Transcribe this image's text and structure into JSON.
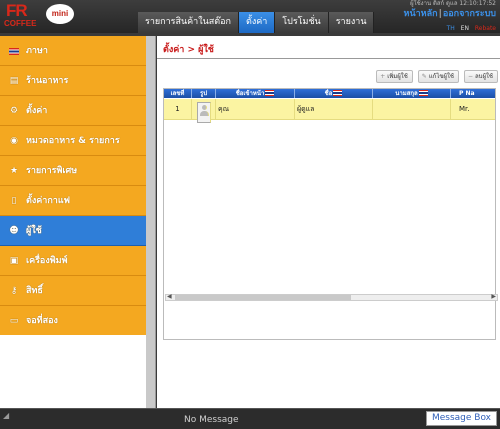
{
  "logo": {
    "brand": "FR",
    "sub": "COFFEE",
    "badge": "mini"
  },
  "nav": {
    "tabs": [
      "รายการสินค้าในสต๊อก",
      "ตั้งค่า",
      "โปรโมชั่น",
      "รายงาน"
    ],
    "active": 1
  },
  "header": {
    "user_info": "ผู้ใช้งาน ดิสก์ ดูแล 12:10:17:52",
    "home": "หน้าหลัก",
    "logout": "ออกจากระบบ",
    "lang_th": "TH",
    "lang_en": "EN",
    "lang_other": "Rebate"
  },
  "sidebar": {
    "items": [
      {
        "label": "ภาษา",
        "icon": "flag-icon"
      },
      {
        "label": "ร้านอาหาร",
        "icon": "store-icon"
      },
      {
        "label": "ตั้งค่า",
        "icon": "gear-icon"
      },
      {
        "label": "หมวดอาหาร & รายการ",
        "icon": "plate-icon"
      },
      {
        "label": "รายการพิเศษ",
        "icon": "star-icon"
      },
      {
        "label": "ตั้งค่ากาแฟ",
        "icon": "cup-icon"
      },
      {
        "label": "ผู้ใช้",
        "icon": "users-icon"
      },
      {
        "label": "เครื่องพิมพ์",
        "icon": "printer-icon"
      },
      {
        "label": "สิทธิ์",
        "icon": "key-icon"
      },
      {
        "label": "จอที่สอง",
        "icon": "monitor-icon"
      }
    ],
    "active": 6
  },
  "main": {
    "breadcrumb": "ตั้งค่า > ผู้ใช้",
    "toolbar": {
      "add": "เพิ่มผู้ใช้",
      "edit": "แก้ไขผู้ใช้",
      "delete": "ลบผู้ใช้"
    },
    "columns": [
      "เลขที่",
      "รูป",
      "ชื่อเข้าหน้า",
      "ชื่อ",
      "นามสกุล",
      "P Na"
    ],
    "rows": [
      {
        "no": "1",
        "login": "คุณ",
        "name": "ผู้ดูแล",
        "surname": "",
        "p": "Mr."
      }
    ]
  },
  "footer": {
    "message": "No Message",
    "message_box": "Message Box"
  },
  "colors": {
    "accent": "#2f7ed8",
    "sidebar": "#f4a820",
    "title": "#c81818"
  }
}
